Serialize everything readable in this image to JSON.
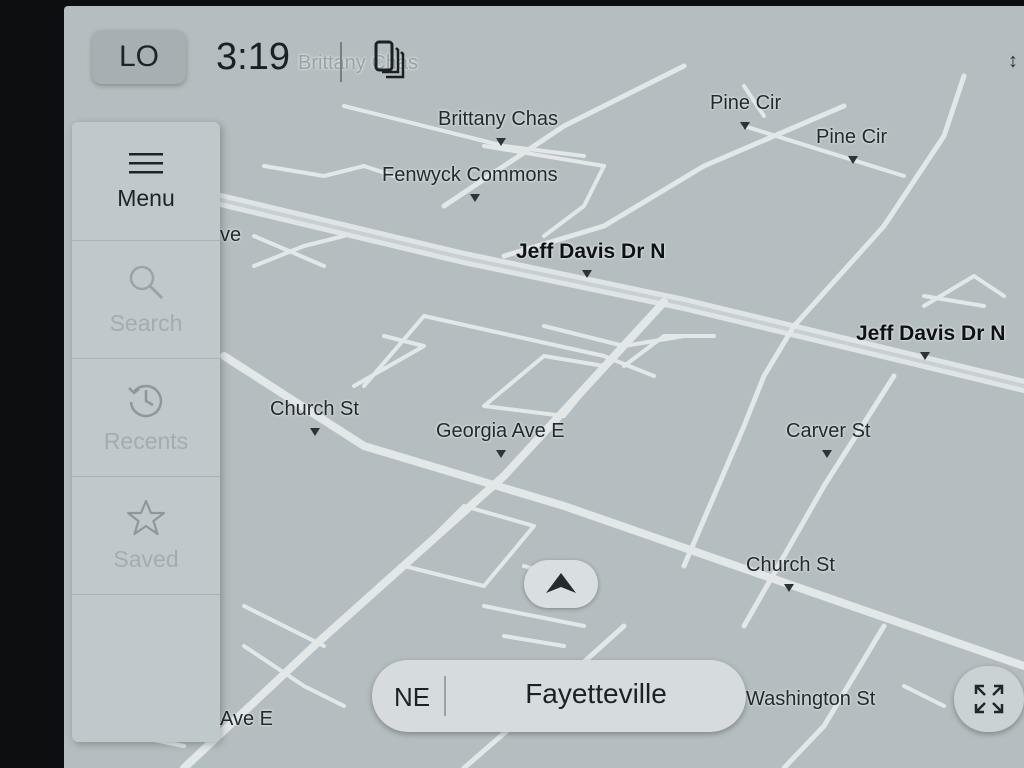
{
  "topbar": {
    "climate_label": "LO",
    "time": "3:19",
    "phone_icon": "phone-connected-icon"
  },
  "sidebar": {
    "items": [
      {
        "label": "Menu",
        "icon": "hamburger-icon",
        "state": "active"
      },
      {
        "label": "Search",
        "icon": "search-icon",
        "state": "disabled"
      },
      {
        "label": "Recents",
        "icon": "history-icon",
        "state": "disabled"
      },
      {
        "label": "Saved",
        "icon": "star-icon",
        "state": "disabled"
      }
    ]
  },
  "map": {
    "streets": [
      {
        "name": "Brittany Chas"
      },
      {
        "name": "Brittany Chas",
        "faded": true
      },
      {
        "name": "Fenwyck Commons"
      },
      {
        "name": "Pine Cir"
      },
      {
        "name": "Pine Cir"
      },
      {
        "name": "ve"
      },
      {
        "name": "Jeff Davis Dr N",
        "bold": true
      },
      {
        "name": "Jeff Davis Dr N",
        "bold": true
      },
      {
        "name": "Church St"
      },
      {
        "name": "Georgia Ave E"
      },
      {
        "name": "Carver St"
      },
      {
        "name": "Church St"
      },
      {
        "name": "Washington St"
      },
      {
        "name": "Ave E"
      }
    ],
    "colors": {
      "background": "#b4bdbf",
      "road": "#e4e9ea"
    }
  },
  "location_bar": {
    "heading": "NE",
    "city": "Fayetteville"
  },
  "controls": {
    "expand_icon": "fullscreen-expand-icon",
    "vehicle_icon": "navigation-arrow-icon"
  }
}
